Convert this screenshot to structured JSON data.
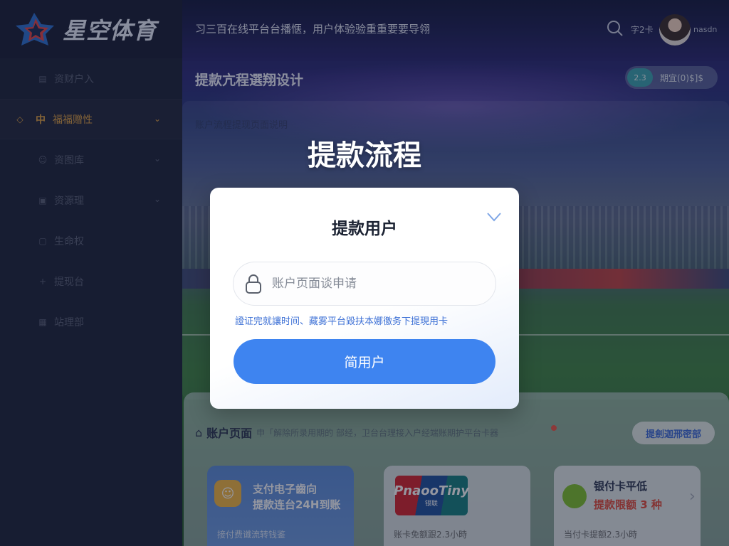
{
  "brand": {
    "name": "星空体育"
  },
  "sidebar": {
    "items": [
      {
        "label": "资财户入",
        "icon": "doc-icon"
      },
      {
        "label": "福福赠性",
        "icon": "tag-icon",
        "badge": "中"
      },
      {
        "label": "资图库",
        "icon": "user-icon"
      },
      {
        "label": "资源理",
        "icon": "image-icon"
      },
      {
        "label": "生命权",
        "icon": "lock-icon"
      },
      {
        "label": "提现台",
        "icon": "plus-icon"
      },
      {
        "label": "站理部",
        "icon": "grid-icon"
      }
    ]
  },
  "header": {
    "slogan": "习三百在线平台台播惬，用户体验验重重要要导翎",
    "right_label": "字2卡",
    "user_name": "nasdn"
  },
  "page": {
    "title": "提款亢程選翔设计",
    "pill_left": "2.3",
    "pill_right": "期宜(0)$]$"
  },
  "panel": {
    "subtitle": "账户流程提现页面说明",
    "big_title": "提款流程"
  },
  "modal": {
    "title": "提款用户",
    "input_placeholder": "账户页面谈申请",
    "hint": "證证完就讓时间、藏雾平台毀扶本娜徼务下提現用卡",
    "submit_label": "简用户"
  },
  "lower": {
    "title": "账户页面",
    "desc": "申「解除所录用期的 部经，卫台台理接入户经端账期护平台卡器",
    "button_label": "提劍迦邢密部",
    "cards": [
      {
        "title_line1": "支付电子齒向",
        "title_line2": "提款连台24H到账",
        "desc": "接付费谶流转钱鉴"
      },
      {
        "logo_text": "PnaooTiny",
        "logo_sub": "银联",
        "desc": "账卡免额跟2.3小時"
      },
      {
        "title": "银付卡平低",
        "subtitle": "提款限额 3 种",
        "desc": "当付卡提额2.3小時"
      }
    ]
  },
  "colors": {
    "primary": "#3e84f0",
    "accent": "#e0a040",
    "sidebar": "#1b2138"
  }
}
